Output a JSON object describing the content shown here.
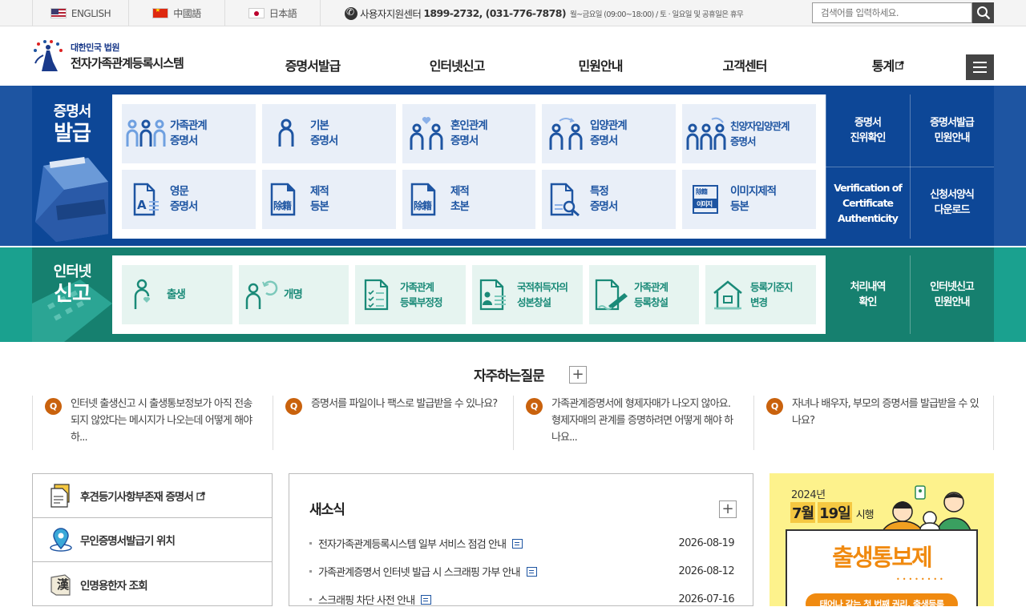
{
  "topbar": {
    "langs": [
      "ENGLISH",
      "中國語",
      "日本語"
    ],
    "support_label": "사용자지원센터",
    "support_numbers": "1899-2732, (031-776-7878)",
    "support_hours": "월~금요일 (09:00~18:00) / 토 · 일요일 및 공휴일은 휴무",
    "search_placeholder": "검색어를 입력하세요."
  },
  "header": {
    "logo_top": "대한민국 법원",
    "logo_main": "전자가족관계등록시스템",
    "nav": [
      "증명서발급",
      "인터넷신고",
      "민원안내",
      "고객센터",
      "통계"
    ]
  },
  "cert_section": {
    "title_small": "증명서",
    "title_big": "발급",
    "cards": [
      {
        "l1": "가족관계",
        "l2": "증명서",
        "icon": "family-icon"
      },
      {
        "l1": "기본",
        "l2": "증명서",
        "icon": "person-icon"
      },
      {
        "l1": "혼인관계",
        "l2": "증명서",
        "icon": "couple-heart-icon"
      },
      {
        "l1": "입양관계",
        "l2": "증명서",
        "icon": "couple-arrows-icon"
      },
      {
        "l1": "친양자입양관계",
        "l2": "증명서",
        "icon": "family-arrows-icon"
      },
      {
        "l1": "영문",
        "l2": "증명서",
        "icon": "english-doc-icon"
      },
      {
        "l1": "제적",
        "l2": "등본",
        "icon": "removed-register-icon"
      },
      {
        "l1": "제적",
        "l2": "초본",
        "icon": "removed-register-icon"
      },
      {
        "l1": "특정",
        "l2": "증명서",
        "icon": "doc-search-icon"
      },
      {
        "l1": "이미지제적",
        "l2": "등본",
        "icon": "image-register-icon"
      }
    ],
    "register_glyph": "除籍",
    "image_glyph": "이미지",
    "image_glyph_top": "除籍",
    "english_glyph": "A",
    "quick": [
      {
        "l1": "증명서",
        "l2": "진위확인"
      },
      {
        "l1": "증명서발급",
        "l2": "민원안내"
      },
      {
        "l1": "Verification of",
        "l2": "Certificate",
        "l3": "Authenticity"
      },
      {
        "l1": "신청서양식",
        "l2": "다운로드"
      }
    ]
  },
  "report_section": {
    "title_small": "인터넷",
    "title_big": "신고",
    "cards": [
      {
        "l1": "출생",
        "l2": "",
        "icon": "birth-icon"
      },
      {
        "l1": "개명",
        "l2": "",
        "icon": "rename-icon"
      },
      {
        "l1": "가족관계",
        "l2": "등록부정정",
        "icon": "checklist-doc-icon"
      },
      {
        "l1": "국적취득자의",
        "l2": "성본창설",
        "icon": "id-doc-icon"
      },
      {
        "l1": "가족관계",
        "l2": "등록창설",
        "icon": "write-doc-icon"
      },
      {
        "l1": "등록기준지",
        "l2": "변경",
        "icon": "house-icon"
      }
    ],
    "quick": [
      {
        "l1": "처리내역",
        "l2": "확인"
      },
      {
        "l1": "인터넷신고",
        "l2": "민원안내"
      }
    ]
  },
  "faq": {
    "title": "자주하는질문",
    "q_mark": "Q",
    "items": [
      "인터넷 출생신고 시 출생통보정보가 아직 전송되지 않았다는 메시지가 나오는데 어떻게 해야 하...",
      "증명서를 파일이나 팩스로 발급받을 수 있나요?",
      "가족관계증명서에 형제자매가 나오지 않아요. 형제자매의 관계를 증명하려면 어떻게 해야 하나요...",
      "자녀나 배우자, 부모의 증명서를 발급받을 수 있나요?"
    ]
  },
  "links": [
    {
      "label": "후견등기사항부존재 증명서",
      "icon": "certificate-doc-icon"
    },
    {
      "label": "무인증명서발급기 위치",
      "icon": "map-pin-icon"
    },
    {
      "label": "인명용한자 조회",
      "icon": "hanja-book-icon",
      "glyph": "漢"
    }
  ],
  "news": {
    "title": "새소식",
    "items": [
      {
        "title": "전자가족관계등록시스템 일부 서비스 점검 안내",
        "date": "2026-08-19"
      },
      {
        "title": "가족관계증명서 인터넷 발급 시 스크래핑 가부 안내",
        "date": "2026-08-12"
      },
      {
        "title": "스크래핑 차단 사전 안내",
        "date": "2026-07-16"
      }
    ]
  },
  "banner": {
    "year": "2024년",
    "date_month": "7월",
    "date_day": "19일",
    "date_suffix": "시행",
    "headline": "출생통보제",
    "sub": "태어나 같는 첫 번째 권리, 출생등록"
  },
  "colors": {
    "blue": "#1e55a2",
    "green": "#1aa18f",
    "orange": "#c9620d"
  }
}
